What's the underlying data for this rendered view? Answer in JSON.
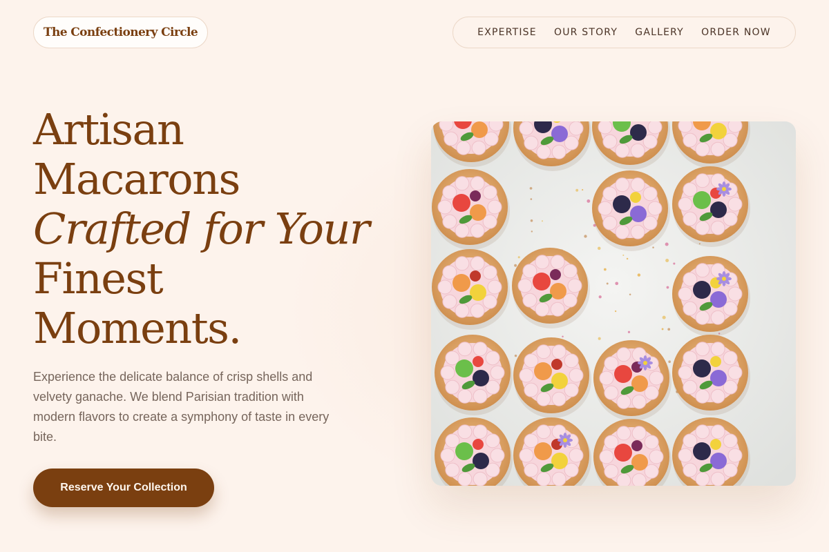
{
  "brand": {
    "name": "The Confectionery Circle"
  },
  "nav": {
    "items": [
      {
        "label": "EXPERTISE"
      },
      {
        "label": "OUR STORY"
      },
      {
        "label": "GALLERY"
      },
      {
        "label": "ORDER NOW"
      }
    ]
  },
  "hero": {
    "line1": "Artisan",
    "line2": "Macarons",
    "line3": "Crafted for Your",
    "line4": "Finest",
    "line5": "Moments.",
    "description": "Experience the delicate balance of crisp shells and velvety ganache. We blend Parisian tradition with modern flavors to create a symphony of taste in every bite.",
    "cta_label": "Reserve Your Collection"
  },
  "colors": {
    "background": "#fdf3ec",
    "accent": "#7a3f10",
    "body_text": "#76655b"
  },
  "image": {
    "icon": "pastry-tray-photo"
  }
}
